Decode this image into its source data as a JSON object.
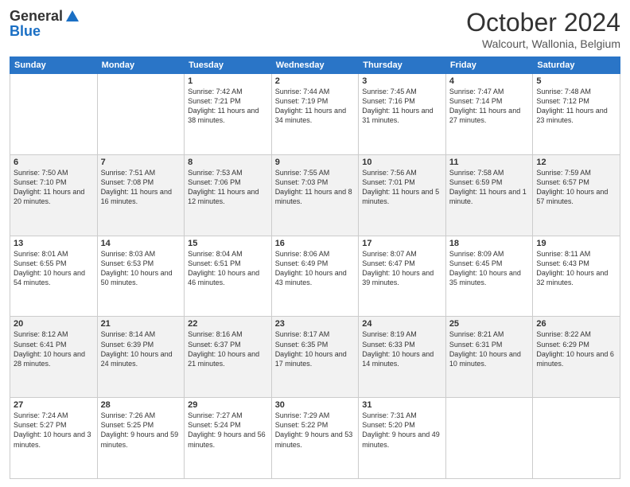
{
  "header": {
    "logo_general": "General",
    "logo_blue": "Blue",
    "month_title": "October 2024",
    "location": "Walcourt, Wallonia, Belgium"
  },
  "days_of_week": [
    "Sunday",
    "Monday",
    "Tuesday",
    "Wednesday",
    "Thursday",
    "Friday",
    "Saturday"
  ],
  "weeks": [
    [
      {
        "day": "",
        "info": ""
      },
      {
        "day": "",
        "info": ""
      },
      {
        "day": "1",
        "info": "Sunrise: 7:42 AM\nSunset: 7:21 PM\nDaylight: 11 hours and 38 minutes."
      },
      {
        "day": "2",
        "info": "Sunrise: 7:44 AM\nSunset: 7:19 PM\nDaylight: 11 hours and 34 minutes."
      },
      {
        "day": "3",
        "info": "Sunrise: 7:45 AM\nSunset: 7:16 PM\nDaylight: 11 hours and 31 minutes."
      },
      {
        "day": "4",
        "info": "Sunrise: 7:47 AM\nSunset: 7:14 PM\nDaylight: 11 hours and 27 minutes."
      },
      {
        "day": "5",
        "info": "Sunrise: 7:48 AM\nSunset: 7:12 PM\nDaylight: 11 hours and 23 minutes."
      }
    ],
    [
      {
        "day": "6",
        "info": "Sunrise: 7:50 AM\nSunset: 7:10 PM\nDaylight: 11 hours and 20 minutes."
      },
      {
        "day": "7",
        "info": "Sunrise: 7:51 AM\nSunset: 7:08 PM\nDaylight: 11 hours and 16 minutes."
      },
      {
        "day": "8",
        "info": "Sunrise: 7:53 AM\nSunset: 7:06 PM\nDaylight: 11 hours and 12 minutes."
      },
      {
        "day": "9",
        "info": "Sunrise: 7:55 AM\nSunset: 7:03 PM\nDaylight: 11 hours and 8 minutes."
      },
      {
        "day": "10",
        "info": "Sunrise: 7:56 AM\nSunset: 7:01 PM\nDaylight: 11 hours and 5 minutes."
      },
      {
        "day": "11",
        "info": "Sunrise: 7:58 AM\nSunset: 6:59 PM\nDaylight: 11 hours and 1 minute."
      },
      {
        "day": "12",
        "info": "Sunrise: 7:59 AM\nSunset: 6:57 PM\nDaylight: 10 hours and 57 minutes."
      }
    ],
    [
      {
        "day": "13",
        "info": "Sunrise: 8:01 AM\nSunset: 6:55 PM\nDaylight: 10 hours and 54 minutes."
      },
      {
        "day": "14",
        "info": "Sunrise: 8:03 AM\nSunset: 6:53 PM\nDaylight: 10 hours and 50 minutes."
      },
      {
        "day": "15",
        "info": "Sunrise: 8:04 AM\nSunset: 6:51 PM\nDaylight: 10 hours and 46 minutes."
      },
      {
        "day": "16",
        "info": "Sunrise: 8:06 AM\nSunset: 6:49 PM\nDaylight: 10 hours and 43 minutes."
      },
      {
        "day": "17",
        "info": "Sunrise: 8:07 AM\nSunset: 6:47 PM\nDaylight: 10 hours and 39 minutes."
      },
      {
        "day": "18",
        "info": "Sunrise: 8:09 AM\nSunset: 6:45 PM\nDaylight: 10 hours and 35 minutes."
      },
      {
        "day": "19",
        "info": "Sunrise: 8:11 AM\nSunset: 6:43 PM\nDaylight: 10 hours and 32 minutes."
      }
    ],
    [
      {
        "day": "20",
        "info": "Sunrise: 8:12 AM\nSunset: 6:41 PM\nDaylight: 10 hours and 28 minutes."
      },
      {
        "day": "21",
        "info": "Sunrise: 8:14 AM\nSunset: 6:39 PM\nDaylight: 10 hours and 24 minutes."
      },
      {
        "day": "22",
        "info": "Sunrise: 8:16 AM\nSunset: 6:37 PM\nDaylight: 10 hours and 21 minutes."
      },
      {
        "day": "23",
        "info": "Sunrise: 8:17 AM\nSunset: 6:35 PM\nDaylight: 10 hours and 17 minutes."
      },
      {
        "day": "24",
        "info": "Sunrise: 8:19 AM\nSunset: 6:33 PM\nDaylight: 10 hours and 14 minutes."
      },
      {
        "day": "25",
        "info": "Sunrise: 8:21 AM\nSunset: 6:31 PM\nDaylight: 10 hours and 10 minutes."
      },
      {
        "day": "26",
        "info": "Sunrise: 8:22 AM\nSunset: 6:29 PM\nDaylight: 10 hours and 6 minutes."
      }
    ],
    [
      {
        "day": "27",
        "info": "Sunrise: 7:24 AM\nSunset: 5:27 PM\nDaylight: 10 hours and 3 minutes."
      },
      {
        "day": "28",
        "info": "Sunrise: 7:26 AM\nSunset: 5:25 PM\nDaylight: 9 hours and 59 minutes."
      },
      {
        "day": "29",
        "info": "Sunrise: 7:27 AM\nSunset: 5:24 PM\nDaylight: 9 hours and 56 minutes."
      },
      {
        "day": "30",
        "info": "Sunrise: 7:29 AM\nSunset: 5:22 PM\nDaylight: 9 hours and 53 minutes."
      },
      {
        "day": "31",
        "info": "Sunrise: 7:31 AM\nSunset: 5:20 PM\nDaylight: 9 hours and 49 minutes."
      },
      {
        "day": "",
        "info": ""
      },
      {
        "day": "",
        "info": ""
      }
    ]
  ]
}
